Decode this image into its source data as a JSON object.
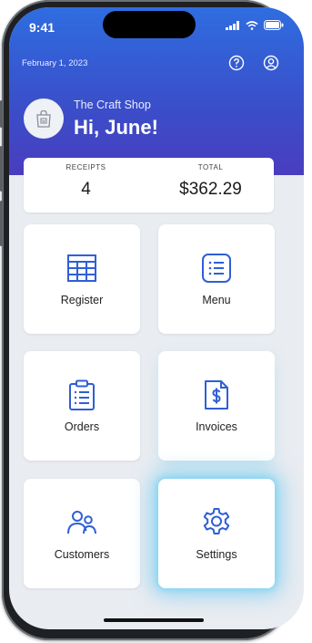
{
  "status_bar": {
    "time": "9:41"
  },
  "header": {
    "date": "February 1, 2023",
    "help_icon": "help-circle-icon",
    "account_icon": "account-icon",
    "shop_name": "The Craft Shop",
    "greeting": "Hi, June!",
    "shop_icon": "shopping-bag-icon"
  },
  "stats": {
    "receipts_label": "RECEIPTS",
    "receipts_value": "4",
    "total_label": "TOTAL",
    "total_value": "$362.29"
  },
  "tiles": [
    {
      "label": "Register",
      "icon": "register-grid-icon"
    },
    {
      "label": "Menu",
      "icon": "list-icon"
    },
    {
      "label": "Orders",
      "icon": "clipboard-icon"
    },
    {
      "label": "Invoices",
      "icon": "invoice-dollar-icon"
    },
    {
      "label": "Customers",
      "icon": "people-icon"
    },
    {
      "label": "Settings",
      "icon": "gear-icon"
    }
  ],
  "colors": {
    "brand_blue": "#2f6de0",
    "icon_blue": "#2f5fd6",
    "highlight_glow": "#78cdf0"
  }
}
